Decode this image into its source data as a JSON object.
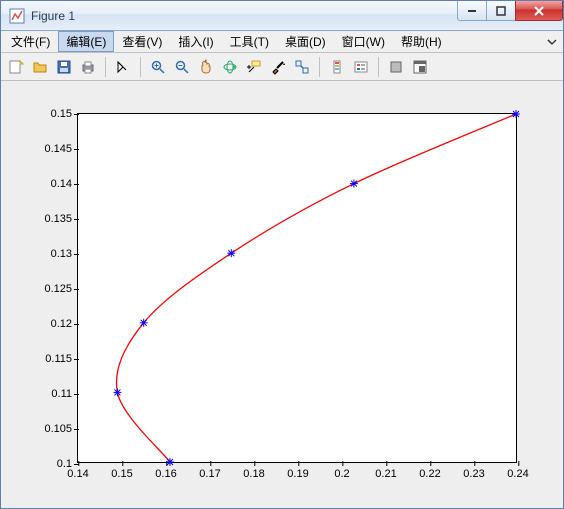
{
  "window": {
    "title": "Figure 1"
  },
  "menu": {
    "items": [
      {
        "label": "文件(F)",
        "active": false
      },
      {
        "label": "编辑(E)",
        "active": true
      },
      {
        "label": "查看(V)",
        "active": false
      },
      {
        "label": "插入(I)",
        "active": false
      },
      {
        "label": "工具(T)",
        "active": false
      },
      {
        "label": "桌面(D)",
        "active": false
      },
      {
        "label": "窗口(W)",
        "active": false
      },
      {
        "label": "帮助(H)",
        "active": false
      }
    ]
  },
  "toolbar": {
    "buttons": [
      {
        "name": "new-figure-icon"
      },
      {
        "name": "open-icon"
      },
      {
        "name": "save-icon"
      },
      {
        "name": "print-icon"
      },
      {
        "sep": true
      },
      {
        "name": "edit-plot-icon"
      },
      {
        "sep": true
      },
      {
        "name": "zoom-in-icon"
      },
      {
        "name": "zoom-out-icon"
      },
      {
        "name": "pan-icon"
      },
      {
        "name": "rotate3d-icon"
      },
      {
        "name": "data-cursor-icon"
      },
      {
        "name": "brush-icon"
      },
      {
        "name": "link-icon"
      },
      {
        "sep": true
      },
      {
        "name": "colorbar-icon"
      },
      {
        "name": "legend-icon"
      },
      {
        "sep": true
      },
      {
        "name": "hide-tools-icon"
      },
      {
        "name": "dock-icon"
      }
    ]
  },
  "chart_data": {
    "type": "line",
    "title": "",
    "xlabel": "",
    "ylabel": "",
    "xlim": [
      0.14,
      0.24
    ],
    "ylim": [
      0.1,
      0.15
    ],
    "xticks": [
      0.14,
      0.15,
      0.16,
      0.17,
      0.18,
      0.19,
      0.2,
      0.21,
      0.22,
      0.23,
      0.24
    ],
    "yticks": [
      0.1,
      0.105,
      0.11,
      0.115,
      0.12,
      0.125,
      0.13,
      0.135,
      0.14,
      0.145,
      0.15
    ],
    "markers": [
      {
        "x": 0.161,
        "y": 0.1
      },
      {
        "x": 0.149,
        "y": 0.11
      },
      {
        "x": 0.155,
        "y": 0.12
      },
      {
        "x": 0.175,
        "y": 0.13
      },
      {
        "x": 0.203,
        "y": 0.14
      },
      {
        "x": 0.24,
        "y": 0.15
      }
    ],
    "line_color": "#ff0000",
    "marker_color": "#0000ff"
  }
}
